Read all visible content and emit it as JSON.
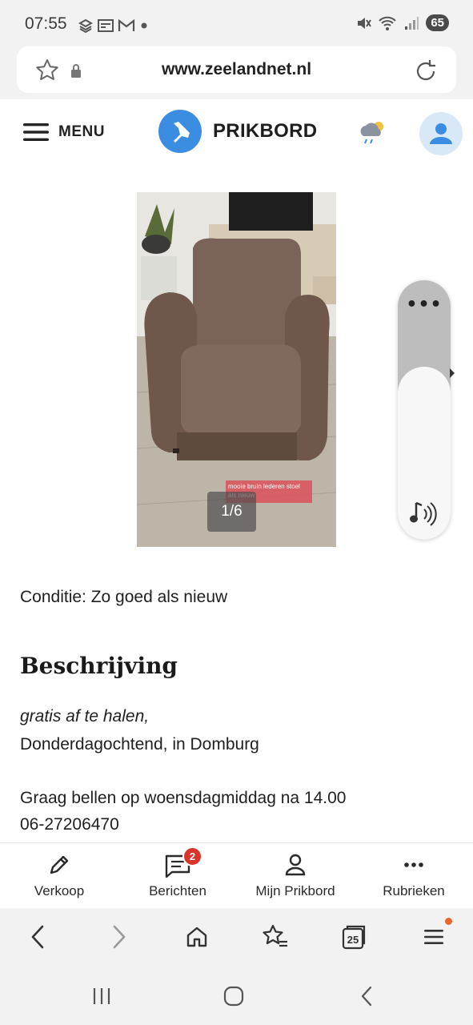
{
  "status_bar": {
    "time": "07:55",
    "battery": "65",
    "left_icons": [
      "layers-icon",
      "newspaper-icon",
      "gmail-icon",
      "dot-icon"
    ],
    "right_icons": [
      "mute-icon",
      "wifi-icon",
      "signal-icon"
    ]
  },
  "browser": {
    "url": "www.zeelandnet.nl"
  },
  "site_header": {
    "menu_label": "MENU",
    "brand_name": "PRIKBORD",
    "brand_color": "#3a8de0"
  },
  "photo": {
    "counter": "1/6",
    "caption": "mooie bruin lederen stoel als nieuw"
  },
  "listing": {
    "condition": "Conditie: Zo goed als nieuw",
    "description_heading": "Beschrijving",
    "description_lines": [
      "gratis af te halen,",
      "Donderdagochtend, in Domburg",
      "Graag bellen op woensdagmiddag na 14.00",
      "06-27206470"
    ]
  },
  "site_nav": {
    "items": [
      {
        "label": "Verkoop",
        "icon": "pencil-icon"
      },
      {
        "label": "Berichten",
        "icon": "message-icon"
      },
      {
        "label": "Mijn Prikbord",
        "icon": "person-icon"
      },
      {
        "label": "Rubrieken",
        "icon": "more-dots-icon"
      }
    ],
    "messages_badge": "2",
    "badge_color": "#d9342b"
  },
  "browser_toolbar": {
    "tab_count": "25",
    "icons": [
      "back-icon",
      "forward-icon",
      "home-icon",
      "bookmarks-icon",
      "tabs-icon",
      "menu-icon"
    ]
  }
}
